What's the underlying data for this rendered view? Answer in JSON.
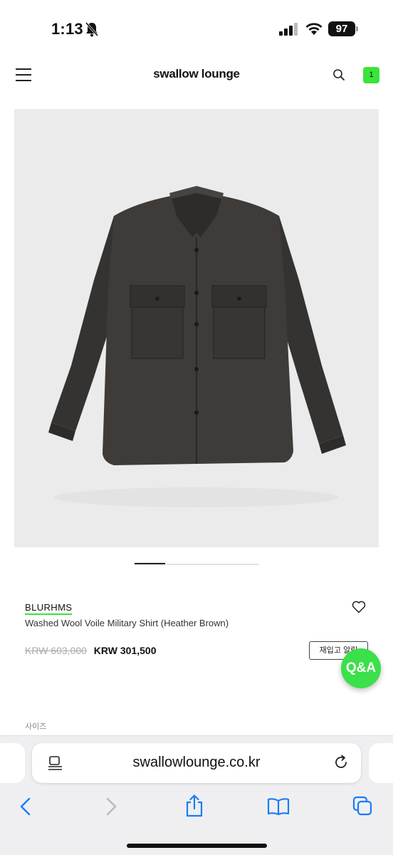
{
  "status_bar": {
    "time": "1:13",
    "battery": "97"
  },
  "header": {
    "brand": "swallow lounge",
    "cart_count": "1"
  },
  "product": {
    "brand": "BLURHMS",
    "name": "Washed Wool Voile Military Shirt (Heather Brown)",
    "original_price": "KRW 603,000",
    "sale_price": "KRW 301,500",
    "restock_label": "재입고 알림",
    "qa_label": "Q&A",
    "size_label": "사이즈"
  },
  "browser": {
    "url": "swallowlounge.co.kr"
  },
  "colors": {
    "accent": "#3be33b",
    "shirt": "#3c3a38",
    "image_bg": "#ebebeb"
  }
}
